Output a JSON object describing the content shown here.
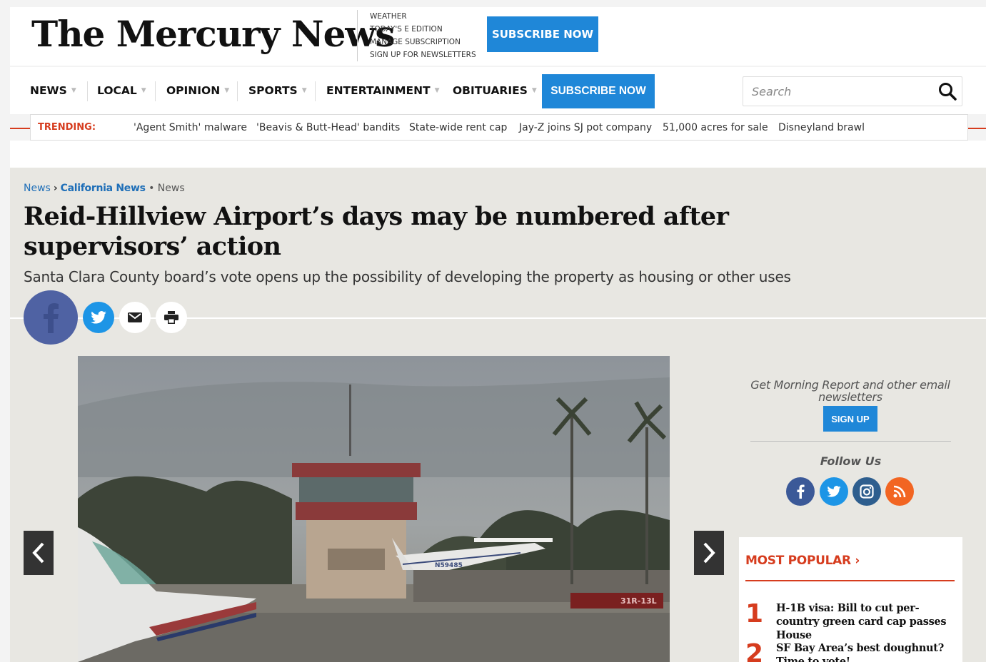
{
  "header": {
    "logo_text": "The Mercury News",
    "top_links": [
      "WEATHER",
      "TODAY'S E EDITION",
      "MANAGE SUBSCRIPTION",
      "SIGN UP FOR NEWSLETTERS"
    ],
    "subscribe_label": "SUBSCRIBE NOW"
  },
  "nav": {
    "items": [
      {
        "label": "NEWS"
      },
      {
        "label": "LOCAL"
      },
      {
        "label": "OPINION"
      },
      {
        "label": "SPORTS"
      },
      {
        "label": "ENTERTAINMENT"
      },
      {
        "label": "OBITUARIES"
      }
    ],
    "subscribe_label": "SUBSCRIBE NOW",
    "search_placeholder": "Search",
    "search_icon": "magnifier-icon"
  },
  "trending": {
    "label": "TRENDING:",
    "items": [
      "'Agent Smith' malware",
      "'Beavis & Butt-Head' bandits",
      "State-wide rent cap",
      "Jay-Z joins SJ pot company",
      "51,000 acres for sale",
      "Disneyland brawl"
    ]
  },
  "article": {
    "breadcrumb": {
      "root": "News",
      "section": "California News",
      "sep": "•",
      "tail": "News"
    },
    "headline": "Reid-Hillview Airport’s days may be numbered after supervisors’ action",
    "subhead": "Santa Clara County board’s vote opens up the possibility of developing the property as housing or other uses",
    "share_icons": [
      "facebook-icon",
      "twitter-icon",
      "mail-icon",
      "print-icon"
    ],
    "photo": {
      "tail_number": "N59485",
      "runway_sign": "31R-13L"
    }
  },
  "sidebar": {
    "newsletter_promo": "Get Morning Report and other email newsletters",
    "signup_label": "SIGN UP",
    "follow_label": "Follow Us",
    "social_icons": [
      "facebook-icon",
      "twitter-icon",
      "instagram-icon",
      "rss-icon"
    ],
    "most_popular": {
      "title": "MOST POPULAR ›",
      "items": [
        {
          "rank": "1",
          "title": "H-1B visa: Bill to cut per-country green card cap passes House"
        },
        {
          "rank": "2",
          "title": "SF Bay Area’s best doughnut? Time to vote!"
        }
      ]
    }
  },
  "colors": {
    "accent_blue": "#1f87d8",
    "accent_red": "#d63c1e",
    "facebook": "#4f62a3",
    "twitter": "#1d95e6"
  }
}
